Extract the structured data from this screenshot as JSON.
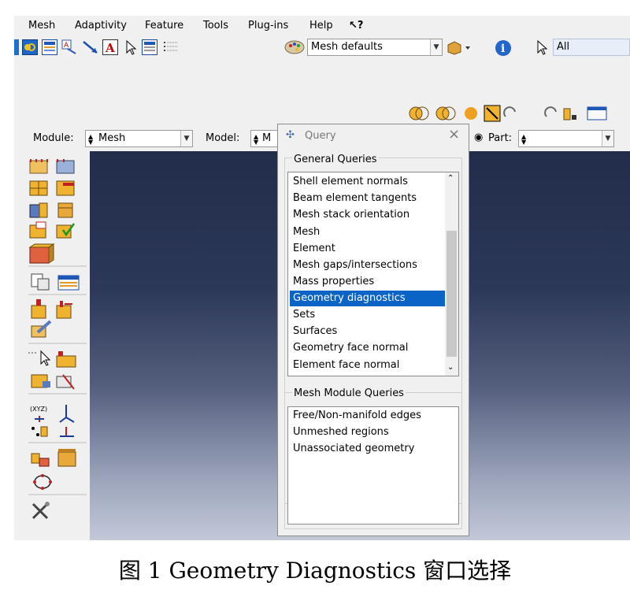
{
  "menubar": {
    "items": [
      "Mesh",
      "Adaptivity",
      "Feature",
      "Tools",
      "Plug-ins",
      "Help"
    ],
    "whats_this": "↖?"
  },
  "toolbar": {
    "mesh_defaults": "Mesh defaults",
    "filter_all": "All"
  },
  "context": {
    "module_label": "Module:",
    "module_value": "Mesh",
    "model_label": "Model:",
    "model_value": "M",
    "part_label": "Part:",
    "part_value": ""
  },
  "query_dialog": {
    "title": "Query",
    "close": "×",
    "general_header": "General Queries",
    "general_items": [
      "Shell element normals",
      "Beam element tangents",
      "Mesh stack orientation",
      "Mesh",
      "Element",
      "Mesh gaps/intersections",
      "Mass properties",
      "Geometry diagnostics",
      "Sets",
      "Surfaces",
      "Geometry face normal",
      "Element face normal"
    ],
    "selected_index": 7,
    "mesh_header": "Mesh Module Queries",
    "mesh_items": [
      "Free/Non-manifold edges",
      "Unmeshed regions",
      "Unassociated geometry"
    ]
  },
  "caption": "图 1   Geometry Diagnostics 窗口选择",
  "colors": {
    "selection": "#0a64c6",
    "viewport_top": "#222d4a",
    "viewport_bottom": "#c2c8d8"
  }
}
